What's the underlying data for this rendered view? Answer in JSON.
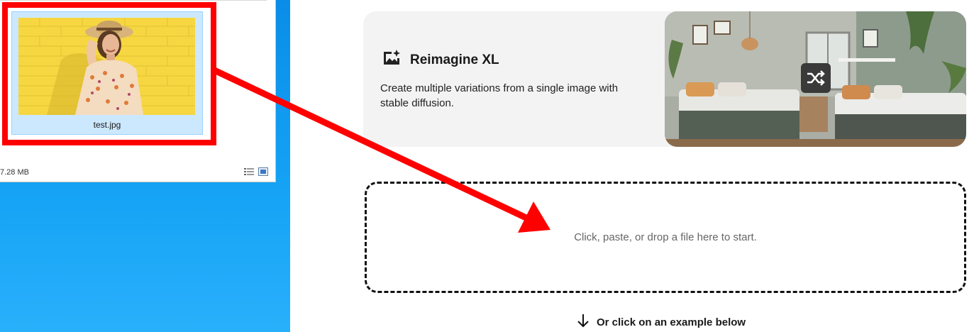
{
  "explorer": {
    "file_name": "test.jpg",
    "status_size": "7.28 MB",
    "view_icons": [
      "details-view-icon",
      "large-icons-view-icon"
    ]
  },
  "card": {
    "icon": "image-sparkle-icon",
    "title": "Reimagine XL",
    "description": "Create multiple variations from a single image with stable diffusion.",
    "badge_icon": "shuffle-icon"
  },
  "dropzone": {
    "text": "Click, paste, or drop a file here to start."
  },
  "examples": {
    "icon": "arrow-down-icon",
    "text": "Or click on an example below"
  },
  "annotation": {
    "color": "#ff0000"
  }
}
